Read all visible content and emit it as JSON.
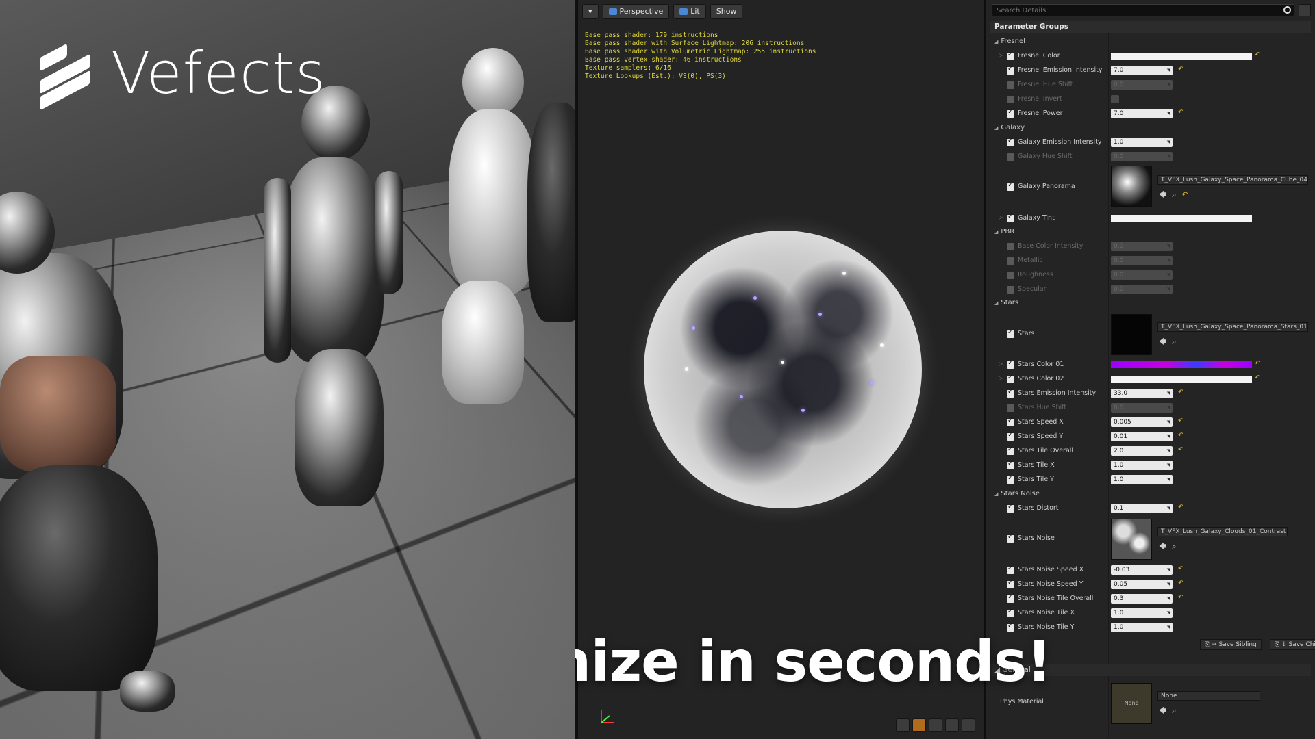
{
  "logo": {
    "text": "Vefects"
  },
  "caption": "Customize in seconds!",
  "viewport": {
    "toolbar": {
      "perspective": "Perspective",
      "lit": "Lit",
      "show": "Show"
    },
    "stats": [
      "Base pass shader: 179 instructions",
      "Base pass shader with Surface Lightmap: 206 instructions",
      "Base pass shader with Volumetric Lightmap: 255 instructions",
      "Base pass vertex shader: 46 instructions",
      "Texture samplers: 6/16",
      "Texture Lookups (Est.): VS(0), PS(3)"
    ]
  },
  "details": {
    "search_placeholder": "Search Details",
    "header": "Parameter Groups",
    "groups": {
      "fresnel": "Fresnel",
      "galaxy": "Galaxy",
      "pbr": "PBR",
      "stars": "Stars",
      "stars_noise": "Stars Noise",
      "general": "General"
    },
    "params": {
      "fresnel_color": "Fresnel Color",
      "fresnel_emission_intensity": {
        "label": "Fresnel Emission Intensity",
        "value": "7.0"
      },
      "fresnel_hue_shift": {
        "label": "Fresnel Hue Shift",
        "value": "0.0"
      },
      "fresnel_invert": "Fresnel Invert",
      "fresnel_power": {
        "label": "Fresnel Power",
        "value": "7.0"
      },
      "galaxy_emission_intensity": {
        "label": "Galaxy Emission Intensity",
        "value": "1.0"
      },
      "galaxy_hue_shift": {
        "label": "Galaxy Hue Shift",
        "value": "0.0"
      },
      "galaxy_panorama": {
        "label": "Galaxy Panorama",
        "texture": "T_VFX_Lush_Galaxy_Space_Panorama_Cube_04"
      },
      "galaxy_tint": "Galaxy Tint",
      "base_color_intensity": {
        "label": "Base Color Intensity",
        "value": "0.0"
      },
      "metallic": {
        "label": "Metallic",
        "value": "0.0"
      },
      "roughness": {
        "label": "Roughness",
        "value": "0.0"
      },
      "specular": {
        "label": "Specular",
        "value": "0.0"
      },
      "stars": {
        "label": "Stars",
        "texture": "T_VFX_Lush_Galaxy_Space_Panorama_Stars_01"
      },
      "stars_color_01": "Stars Color 01",
      "stars_color_02": "Stars Color 02",
      "stars_emission_intensity": {
        "label": "Stars Emission Intensity",
        "value": "33.0"
      },
      "stars_hue_shift": {
        "label": "Stars Hue Shift",
        "value": "0.0"
      },
      "stars_speed_x": {
        "label": "Stars Speed X",
        "value": "0.005"
      },
      "stars_speed_y": {
        "label": "Stars Speed Y",
        "value": "0.01"
      },
      "stars_tile_overall": {
        "label": "Stars Tile Overall",
        "value": "2.0"
      },
      "stars_tile_x": {
        "label": "Stars Tile X",
        "value": "1.0"
      },
      "stars_tile_y": {
        "label": "Stars Tile Y",
        "value": "1.0"
      },
      "stars_distort": {
        "label": "Stars Distort",
        "value": "0.1"
      },
      "stars_noise": {
        "label": "Stars Noise",
        "texture": "T_VFX_Lush_Galaxy_Clouds_01_Contrast"
      },
      "stars_noise_speed_x": {
        "label": "Stars Noise Speed X",
        "value": "-0.03"
      },
      "stars_noise_speed_y": {
        "label": "Stars Noise Speed Y",
        "value": "0.05"
      },
      "stars_noise_tile_overall": {
        "label": "Stars Noise Tile Overall",
        "value": "0.3"
      },
      "stars_noise_tile_x": {
        "label": "Stars Noise Tile X",
        "value": "1.0"
      },
      "stars_noise_tile_y": {
        "label": "Stars Noise Tile Y",
        "value": "1.0"
      },
      "phys_material": {
        "label": "Phys Material",
        "value": "None",
        "thumb": "None"
      }
    },
    "save_sibling": "Save Sibling",
    "save_child": "Save Chil"
  },
  "colors": {
    "accent_reset": "#d1b13a",
    "stars_color_01": "#a300ff",
    "stats_text": "#e0d83a"
  }
}
